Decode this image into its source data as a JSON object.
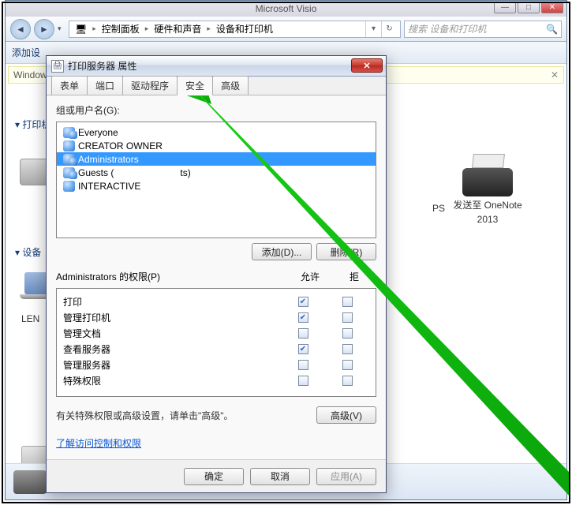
{
  "main": {
    "title_hint": "Microsoft Visio",
    "breadcrumb": {
      "root": "控制面板",
      "mid": "硬件和声音",
      "leaf": "设备和打印机"
    },
    "search_placeholder": "搜索 设备和打印机",
    "cmdbar": "添加设",
    "infobar_left": "Window",
    "side_section_printers": "▾ 打印机",
    "side_section_devices": "▾ 设备",
    "right_label_ps": "PS",
    "right_label_onenote_1": "发送至 OneNote",
    "right_label_onenote_2": "2013",
    "lbl_len": "LEN"
  },
  "dialog": {
    "title": "打印服务器 属性",
    "tabs": {
      "t1": "表单",
      "t2": "端口",
      "t3": "驱动程序",
      "t4": "安全",
      "t5": "高级"
    },
    "group_label": "组或用户名(G):",
    "principals": [
      {
        "name": "Everyone",
        "icon": "group"
      },
      {
        "name": "CREATOR OWNER",
        "icon": "user"
      },
      {
        "name": "Administrators",
        "icon": "group",
        "selected": true
      },
      {
        "name": "Guests (",
        "extra": "ts)",
        "icon": "group"
      },
      {
        "name": "INTERACTIVE",
        "icon": "user"
      }
    ],
    "btn_add": "添加(D)...",
    "btn_remove": "删除(R)",
    "perm_caption": "Administrators 的权限(P)",
    "col_allow": "允许",
    "col_deny": "拒",
    "permissions": [
      {
        "label": "打印",
        "allow": true,
        "deny": false
      },
      {
        "label": "管理打印机",
        "allow": true,
        "deny": false
      },
      {
        "label": "管理文档",
        "allow": false,
        "deny": false
      },
      {
        "label": "查看服务器",
        "allow": true,
        "deny": false
      },
      {
        "label": "管理服务器",
        "allow": false,
        "deny": false
      },
      {
        "label": "特殊权限",
        "allow": false,
        "deny": false
      }
    ],
    "adv_text": "有关特殊权限或高级设置，请单击\"高级\"。",
    "btn_adv": "高级(V)",
    "link": "了解访问控制和权限",
    "btn_ok": "确定",
    "btn_cancel": "取消",
    "btn_apply": "应用(A)"
  }
}
